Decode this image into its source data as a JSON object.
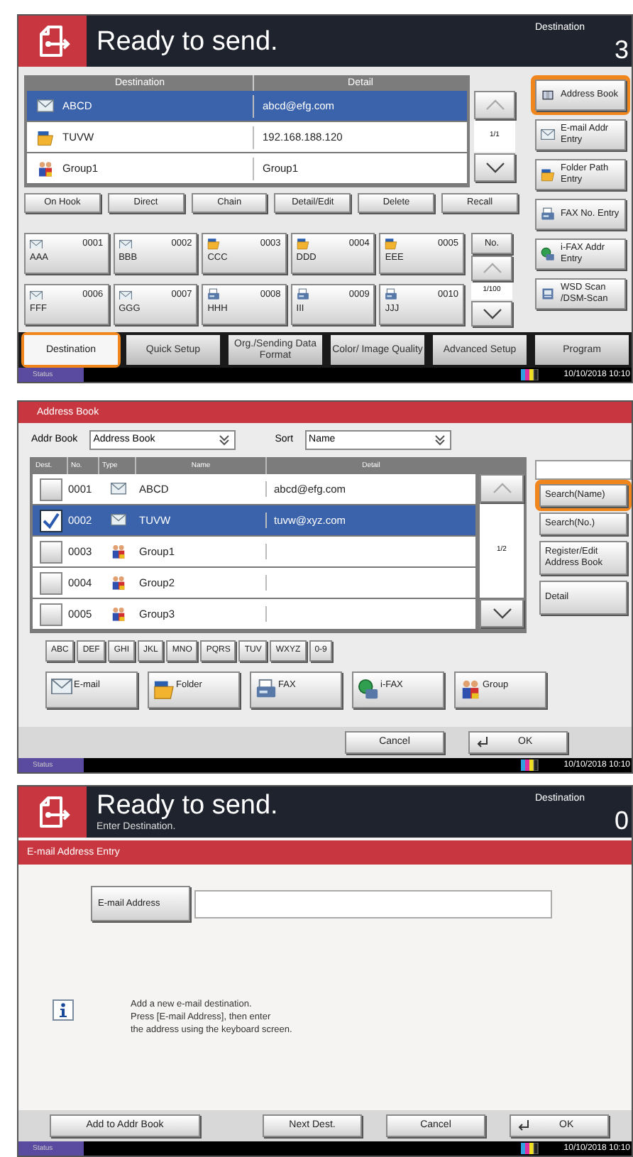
{
  "send_screen": {
    "header": {
      "title": "Ready to send.",
      "destination_label": "Destination",
      "destination_count": "3"
    },
    "destination_list": {
      "columns": [
        "Destination",
        "Detail"
      ],
      "rows": [
        {
          "kind": "email",
          "name": "ABCD",
          "detail": "abcd@efg.com",
          "selected": true
        },
        {
          "kind": "folder",
          "name": "TUVW",
          "detail": "192.168.188.120",
          "selected": false
        },
        {
          "kind": "group",
          "name": "Group1",
          "detail": "Group1",
          "selected": false
        }
      ],
      "page": "1/1"
    },
    "side_buttons": [
      {
        "kind": "book",
        "label": "Address Book",
        "highlighted": true
      },
      {
        "kind": "email",
        "label": "E-mail Addr Entry",
        "highlighted": false
      },
      {
        "kind": "folder",
        "label": "Folder Path Entry",
        "highlighted": false
      },
      {
        "kind": "fax",
        "label": "FAX No. Entry",
        "highlighted": false
      },
      {
        "kind": "ifax",
        "label": "i-FAX Addr Entry",
        "highlighted": false
      },
      {
        "kind": "wsd",
        "label": "WSD Scan /DSM-Scan",
        "highlighted": false
      }
    ],
    "action_buttons": [
      "On Hook",
      "Direct",
      "Chain",
      "Detail/Edit",
      "Delete",
      "Recall"
    ],
    "one_touch_keys": [
      {
        "kind": "email",
        "number": "0001",
        "name": "AAA"
      },
      {
        "kind": "email",
        "number": "0002",
        "name": "BBB"
      },
      {
        "kind": "folder",
        "number": "0003",
        "name": "CCC"
      },
      {
        "kind": "folder",
        "number": "0004",
        "name": "DDD"
      },
      {
        "kind": "folder",
        "number": "0005",
        "name": "EEE"
      },
      {
        "kind": "email",
        "number": "0006",
        "name": "FFF"
      },
      {
        "kind": "email",
        "number": "0007",
        "name": "GGG"
      },
      {
        "kind": "fax",
        "number": "0008",
        "name": "HHH"
      },
      {
        "kind": "fax",
        "number": "0009",
        "name": "III"
      },
      {
        "kind": "fax",
        "number": "0010",
        "name": "JJJ"
      }
    ],
    "one_touch_nav": {
      "label": "No.",
      "page": "1/100"
    },
    "tabs": [
      {
        "label": "Destination",
        "selected": true,
        "highlighted": true
      },
      {
        "label": "Quick Setup",
        "selected": false,
        "highlighted": false
      },
      {
        "label": "Org./Sending Data Format",
        "selected": false,
        "highlighted": false
      },
      {
        "label": "Color/ Image Quality",
        "selected": false,
        "highlighted": false
      },
      {
        "label": "Advanced Setup",
        "selected": false,
        "highlighted": false
      },
      {
        "label": "Program",
        "selected": false,
        "highlighted": false
      }
    ],
    "status_bar": {
      "label": "Status",
      "datetime": "10/10/2018 10:10"
    }
  },
  "address_book": {
    "title": "Address Book",
    "addr_book": {
      "label": "Addr Book",
      "value": "Address Book"
    },
    "sort": {
      "label": "Sort",
      "value": "Name"
    },
    "table": {
      "columns": [
        "Dest.",
        "No.",
        "Type",
        "Name",
        "Detail"
      ],
      "rows": [
        {
          "checked": false,
          "selected": false,
          "number": "0001",
          "kind": "email",
          "name": "ABCD",
          "detail": "abcd@efg.com"
        },
        {
          "checked": true,
          "selected": true,
          "number": "0002",
          "kind": "email",
          "name": "TUVW",
          "detail": "tuvw@xyz.com"
        },
        {
          "checked": false,
          "selected": false,
          "number": "0003",
          "kind": "group",
          "name": "Group1"
        },
        {
          "checked": false,
          "selected": false,
          "number": "0004",
          "kind": "group",
          "name": "Group2"
        },
        {
          "checked": false,
          "selected": false,
          "number": "0005",
          "kind": "group",
          "name": "Group3"
        }
      ],
      "page": "1/2"
    },
    "side_buttons": [
      {
        "label": "Search(Name)",
        "highlighted": true
      },
      {
        "label": "Search(No.)",
        "highlighted": false
      },
      {
        "label": "Register/Edit Address Book",
        "highlighted": false
      },
      {
        "label": "Detail",
        "highlighted": false
      }
    ],
    "index_buttons": [
      "ABC",
      "DEF",
      "GHI",
      "JKL",
      "MNO",
      "PQRS",
      "TUV",
      "WXYZ",
      "0-9"
    ],
    "type_filters": [
      {
        "kind": "email",
        "label": "E-mail"
      },
      {
        "kind": "folder",
        "label": "Folder"
      },
      {
        "kind": "fax",
        "label": "FAX"
      },
      {
        "kind": "ifax",
        "label": "i-FAX"
      },
      {
        "kind": "group",
        "label": "Group"
      }
    ],
    "footer_buttons": [
      {
        "kind": "plain",
        "label": "Cancel"
      },
      {
        "kind": "enter",
        "label": "OK"
      }
    ],
    "status_bar": {
      "label": "Status",
      "datetime": "10/10/2018 10:10"
    }
  },
  "email_entry": {
    "header": {
      "title": "Ready to send.",
      "subtitle": "Enter Destination.",
      "destination_label": "Destination",
      "destination_count": "0"
    },
    "title": "E-mail Address Entry",
    "field": {
      "label": "E-mail Address"
    },
    "message": "Add a new e-mail destination.\nPress [E-mail Address], then enter\nthe address using the keyboard screen.",
    "footer_buttons": [
      {
        "kind": "plain",
        "label": "Add to Addr Book"
      },
      {
        "kind": "plain",
        "label": "Next Dest."
      },
      {
        "kind": "plain",
        "label": "Cancel"
      },
      {
        "kind": "enter",
        "label": "OK"
      }
    ],
    "status_bar": {
      "label": "Status",
      "datetime": "10/10/2018 10:10"
    }
  }
}
